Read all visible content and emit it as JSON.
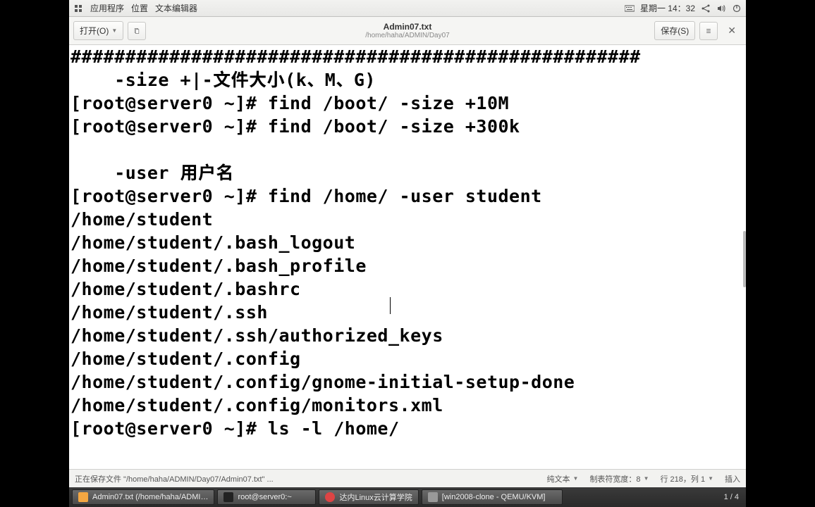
{
  "topbar": {
    "appmenu": "应用程序",
    "location": "位置",
    "editor": "文本编辑器",
    "datetime": "星期一 14：32"
  },
  "toolbar": {
    "open": "打开(O)",
    "save": "保存(S)"
  },
  "window": {
    "title": "Admin07.txt",
    "subtitle": "/home/haha/ADMIN/Day07"
  },
  "content": "####################################################\n    -size +|-文件大小(k、M、G)\n[root@server0 ~]# find /boot/ -size +10M\n[root@server0 ~]# find /boot/ -size +300k\n\n    -user 用户名\n[root@server0 ~]# find /home/ -user student\n/home/student\n/home/student/.bash_logout\n/home/student/.bash_profile\n/home/student/.bashrc\n/home/student/.ssh\n/home/student/.ssh/authorized_keys\n/home/student/.config\n/home/student/.config/gnome-initial-setup-done\n/home/student/.config/monitors.xml\n[root@server0 ~]# ls -l /home/\n",
  "statusbar": {
    "message": "正在保存文件 \"/home/haha/ADMIN/Day07/Admin07.txt\" ...",
    "mode": "纯文本",
    "tabwidth": "制表符宽度：8",
    "position": "行 218，列 1",
    "insert": "插入"
  },
  "taskbar": {
    "t1": "Admin07.txt (/home/haha/ADMI…",
    "t2": "root@server0:~",
    "t3": "达内Linux云计算学院",
    "t4": "[win2008-clone - QEMU/KVM]",
    "ws": "1 / 4"
  }
}
